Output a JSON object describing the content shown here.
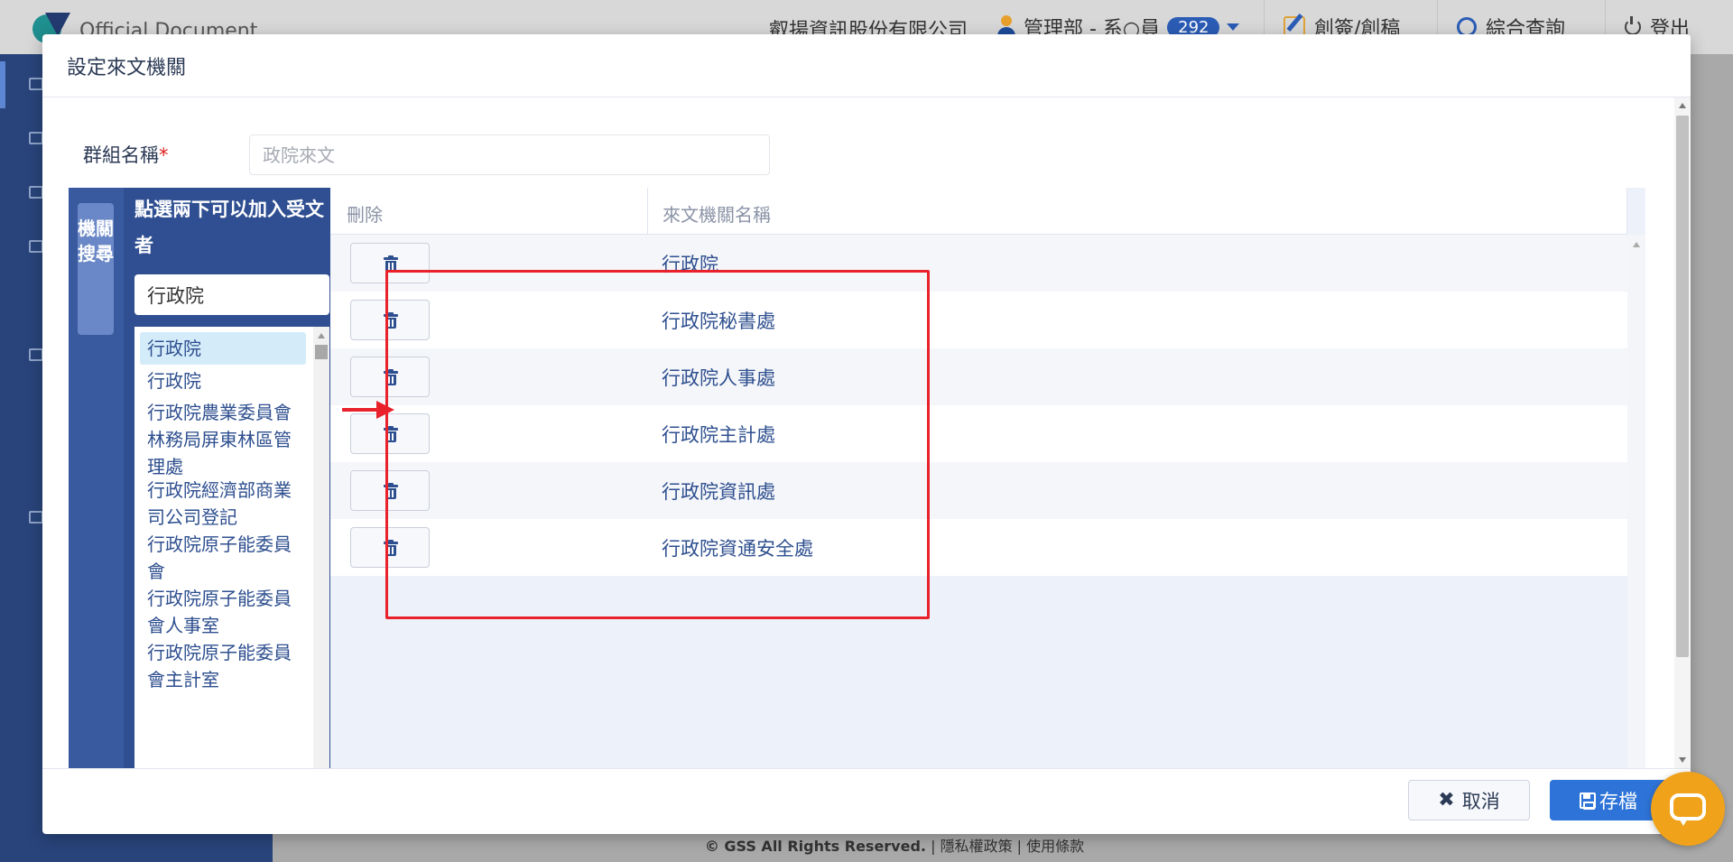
{
  "background": {
    "brand": "Official Document",
    "company": "叡揚資訊股份有限公司",
    "user_label": "管理部 - 系○員",
    "notification_count": "292",
    "nav_create": "創簽/創稿",
    "nav_search": "綜合查詢",
    "nav_logout": "登出",
    "footer_copyright": "© GSS All Rights Reserved.",
    "footer_privacy": "隱私權政策",
    "footer_terms": "使用條款"
  },
  "modal": {
    "title": "設定來文機關",
    "group_name_label": "群組名稱",
    "required_mark": "*",
    "group_name_placeholder": "政院來文",
    "search_tab_label": "機關搜尋",
    "hint_text": "點選兩下可以加入受文者",
    "search_value": "行政院",
    "search_results": [
      "行政院",
      "行政院",
      "行政院農業委員會林務局屏東林區管理處",
      "行政院經濟部商業司公司登記",
      "行政院原子能委員會",
      "行政院原子能委員會人事室",
      "行政院原子能委員會主計室"
    ],
    "grid_headers": {
      "delete": "刪除",
      "agency_name": "來文機關名稱"
    },
    "rows": [
      {
        "name": "行政院"
      },
      {
        "name": "行政院秘書處"
      },
      {
        "name": "行政院人事處"
      },
      {
        "name": "行政院主計處"
      },
      {
        "name": "行政院資訊處"
      },
      {
        "name": "行政院資通安全處"
      }
    ],
    "cancel_label": "取消",
    "save_label": "存檔"
  },
  "colors": {
    "primary": "#2e74d8",
    "panel": "#2f4f92",
    "annotation_red": "#e8212b",
    "chat_button": "#f0a21a"
  },
  "icons": [
    "logo-icon",
    "user-icon",
    "edit-icon",
    "search-icon",
    "power-icon",
    "trash-icon",
    "close-icon",
    "floppy-icon",
    "chat-icon"
  ]
}
